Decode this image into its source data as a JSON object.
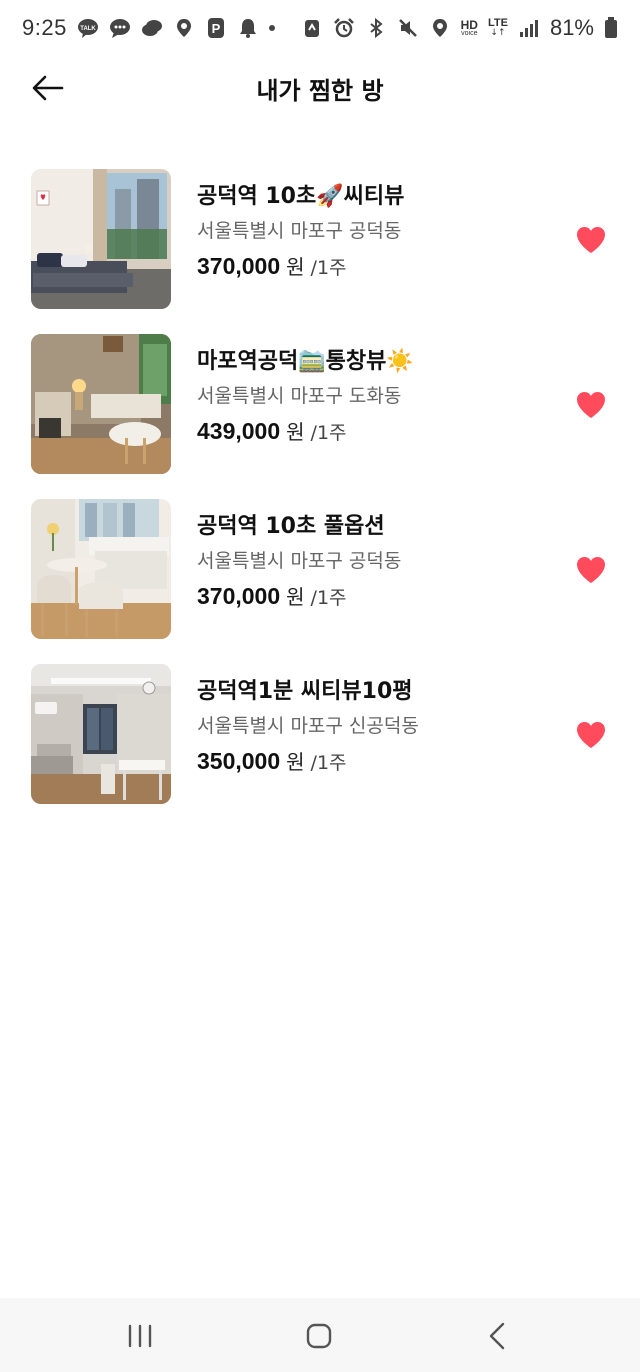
{
  "status_bar": {
    "time": "9:25",
    "battery_percent": "81%",
    "hd_label_top": "HD",
    "hd_label_bottom": "voice",
    "lte_label": "LTE"
  },
  "header": {
    "title": "내가 찜한 방"
  },
  "rooms": [
    {
      "name": "공덕역 10초🚀씨티뷰",
      "address": "서울특별시 마포구 공덕동",
      "price": "370,000",
      "currency": "원",
      "period": "/1주"
    },
    {
      "name": "마포역공덕🚞통창뷰☀️",
      "address": "서울특별시 마포구 도화동",
      "price": "439,000",
      "currency": "원",
      "period": "/1주"
    },
    {
      "name": "공덕역 10초 풀옵션",
      "address": "서울특별시 마포구 공덕동",
      "price": "370,000",
      "currency": "원",
      "period": "/1주"
    },
    {
      "name": "공덕역1분 씨티뷰10평",
      "address": "서울특별시 마포구 신공덕동",
      "price": "350,000",
      "currency": "원",
      "period": "/1주"
    }
  ],
  "colors": {
    "heart": "#ff4b5c",
    "title": "#111111",
    "address": "#666666"
  },
  "icons": {
    "back": "arrow-left-icon",
    "favorite": "heart-icon",
    "nav_recents": "recents-icon",
    "nav_home": "home-icon",
    "nav_back": "chevron-left-icon"
  }
}
